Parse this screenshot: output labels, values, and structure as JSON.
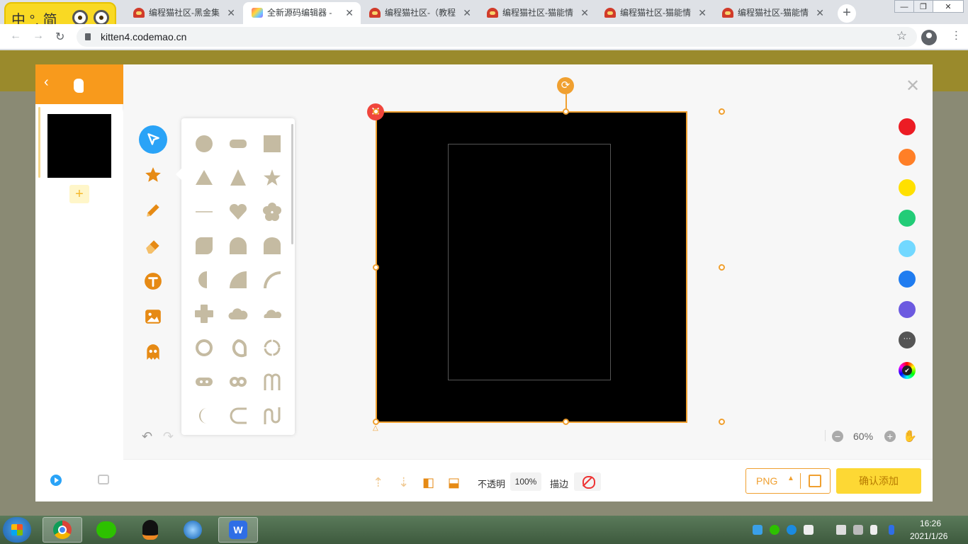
{
  "browser": {
    "tabs": [
      {
        "title": "编程猫社区-黑金集",
        "icon": "codemao-cat-icon"
      },
      {
        "title": "全新源码编辑器 - ",
        "icon": "source-editor-icon",
        "active": true
      },
      {
        "title": "编程猫社区-（教程",
        "icon": "codemao-cat-icon"
      },
      {
        "title": "编程猫社区-猫能情",
        "icon": "codemao-cat-icon"
      },
      {
        "title": "编程猫社区-猫能情",
        "icon": "codemao-cat-icon"
      },
      {
        "title": "编程猫社区-猫能情",
        "icon": "codemao-cat-icon"
      }
    ],
    "tab_close_glyph": "✕",
    "new_tab_glyph": "+",
    "url": "kitten4.codemao.cn",
    "window_controls": {
      "minimize": "—",
      "maximize": "❐",
      "close": "✕"
    }
  },
  "ime": {
    "text": "中 °, 简"
  },
  "modal": {
    "close_glyph": "✕",
    "left_panel": {
      "back_glyph": "‹",
      "add_glyph": "+"
    },
    "tools": [
      {
        "name": "select-tool",
        "icon": "cursor-icon",
        "selected": true
      },
      {
        "name": "shape-tool",
        "icon": "star-icon"
      },
      {
        "name": "pen-tool",
        "icon": "pencil-icon"
      },
      {
        "name": "eraser-tool",
        "icon": "eraser-icon"
      },
      {
        "name": "text-tool",
        "icon": "text-icon"
      },
      {
        "name": "image-tool",
        "icon": "image-icon"
      },
      {
        "name": "character-tool",
        "icon": "ghost-icon"
      }
    ],
    "history": {
      "undo_glyph": "↶",
      "redo_glyph": "↷"
    },
    "shapes": [
      "circle",
      "rounded-rect",
      "square",
      "triangle",
      "triangle-tall",
      "star",
      "line",
      "heart",
      "flower",
      "leaf",
      "dome-corner",
      "arch",
      "half-circle",
      "quarter-circle",
      "arc",
      "cross",
      "cloud",
      "cloud-small",
      "ring",
      "speech-ring",
      "dashed-ring",
      "pill-holes",
      "double-ring",
      "m-shape",
      "crescent",
      "c-shape",
      "wave"
    ],
    "canvas": {
      "rotate_glyph": "⟳",
      "delete_glyph": "✕",
      "anchor_glyph": "△"
    },
    "colors": [
      "#ec1c24",
      "#ff7f27",
      "#ffe000",
      "#22cc77",
      "#72d8ff",
      "#1f7cf0",
      "#6c5ae0"
    ],
    "more_colors_glyph": "···",
    "zoom": {
      "value": "60%",
      "minus": "−",
      "plus": "+",
      "hand_glyph": "✋"
    },
    "bottom": {
      "opacity_label": "不透明",
      "opacity_value": "100%",
      "stroke_label": "描边",
      "format": "PNG",
      "format_caret": "▲",
      "confirm": "确认添加",
      "layer_up_glyph": "⇡",
      "layer_down_glyph": "⇣",
      "flip_h_glyph": "◧",
      "flip_v_glyph": "⬓"
    }
  },
  "taskbar": {
    "apps": [
      "chrome-icon",
      "wechat-icon",
      "qq-icon",
      "browser-icon",
      "wps-icon"
    ],
    "wps_label": "W",
    "time": "16:26",
    "date": "2021/1/26"
  }
}
